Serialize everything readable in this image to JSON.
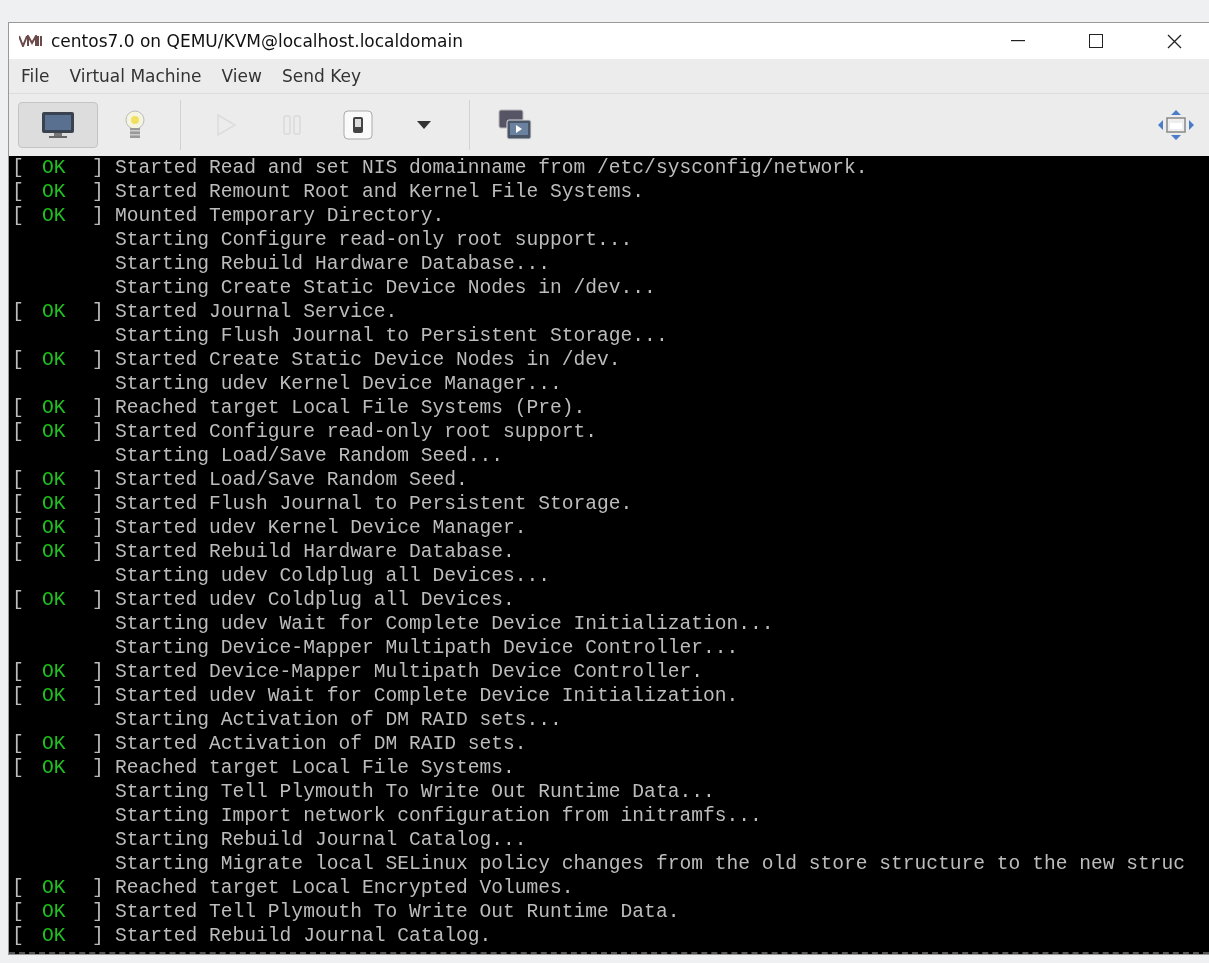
{
  "window": {
    "title": "centos7.0 on QEMU/KVM@localhost.localdomain"
  },
  "menu": [
    "File",
    "Virtual Machine",
    "View",
    "Send Key"
  ],
  "toolbar": [
    {
      "kind": "console",
      "selected": true,
      "disabled": false
    },
    {
      "kind": "details",
      "selected": false,
      "disabled": false
    },
    {
      "kind": "separator"
    },
    {
      "kind": "run",
      "selected": false,
      "disabled": true
    },
    {
      "kind": "pause",
      "selected": false,
      "disabled": true
    },
    {
      "kind": "shutdown",
      "selected": false,
      "disabled": false
    },
    {
      "kind": "dropdown",
      "selected": false,
      "disabled": false
    },
    {
      "kind": "separator"
    },
    {
      "kind": "snapshots",
      "selected": false,
      "disabled": false
    },
    {
      "kind": "spacer"
    },
    {
      "kind": "fullscreen",
      "selected": false,
      "disabled": false
    }
  ],
  "console": {
    "lines": [
      {
        "kind": "status",
        "status": [
          "[",
          "OK",
          "]"
        ],
        "text": "Started Read and set NIS domainname from /etc/sysconfig/network."
      },
      {
        "kind": "status",
        "status": [
          "[",
          "OK",
          "]"
        ],
        "text": "Started Remount Root and Kernel File Systems."
      },
      {
        "kind": "status",
        "status": [
          "[",
          "OK",
          "]"
        ],
        "text": "Mounted Temporary Directory."
      },
      {
        "kind": "plain",
        "text": "Starting Configure read-only root support..."
      },
      {
        "kind": "plain",
        "text": "Starting Rebuild Hardware Database..."
      },
      {
        "kind": "plain",
        "text": "Starting Create Static Device Nodes in /dev..."
      },
      {
        "kind": "status",
        "status": [
          "[",
          "OK",
          "]"
        ],
        "text": "Started Journal Service."
      },
      {
        "kind": "plain",
        "text": "Starting Flush Journal to Persistent Storage..."
      },
      {
        "kind": "status",
        "status": [
          "[",
          "OK",
          "]"
        ],
        "text": "Started Create Static Device Nodes in /dev."
      },
      {
        "kind": "plain",
        "text": "Starting udev Kernel Device Manager..."
      },
      {
        "kind": "status",
        "status": [
          "[",
          "OK",
          "]"
        ],
        "text": "Reached target Local File Systems (Pre)."
      },
      {
        "kind": "status",
        "status": [
          "[",
          "OK",
          "]"
        ],
        "text": "Started Configure read-only root support."
      },
      {
        "kind": "plain",
        "text": "Starting Load/Save Random Seed..."
      },
      {
        "kind": "status",
        "status": [
          "[",
          "OK",
          "]"
        ],
        "text": "Started Load/Save Random Seed."
      },
      {
        "kind": "status",
        "status": [
          "[",
          "OK",
          "]"
        ],
        "text": "Started Flush Journal to Persistent Storage."
      },
      {
        "kind": "status",
        "status": [
          "[",
          "OK",
          "]"
        ],
        "text": "Started udev Kernel Device Manager."
      },
      {
        "kind": "status",
        "status": [
          "[",
          "OK",
          "]"
        ],
        "text": "Started Rebuild Hardware Database."
      },
      {
        "kind": "plain",
        "text": "Starting udev Coldplug all Devices..."
      },
      {
        "kind": "status",
        "status": [
          "[",
          "OK",
          "]"
        ],
        "text": "Started udev Coldplug all Devices."
      },
      {
        "kind": "plain",
        "text": "Starting udev Wait for Complete Device Initialization..."
      },
      {
        "kind": "plain",
        "text": "Starting Device-Mapper Multipath Device Controller..."
      },
      {
        "kind": "status",
        "status": [
          "[",
          "OK",
          "]"
        ],
        "text": "Started Device-Mapper Multipath Device Controller."
      },
      {
        "kind": "status",
        "status": [
          "[",
          "OK",
          "]"
        ],
        "text": "Started udev Wait for Complete Device Initialization."
      },
      {
        "kind": "plain",
        "text": "Starting Activation of DM RAID sets..."
      },
      {
        "kind": "status",
        "status": [
          "[",
          "OK",
          "]"
        ],
        "text": "Started Activation of DM RAID sets."
      },
      {
        "kind": "status",
        "status": [
          "[",
          "OK",
          "]"
        ],
        "text": "Reached target Local File Systems."
      },
      {
        "kind": "plain",
        "text": "Starting Tell Plymouth To Write Out Runtime Data..."
      },
      {
        "kind": "plain",
        "text": "Starting Import network configuration from initramfs..."
      },
      {
        "kind": "plain",
        "text": "Starting Rebuild Journal Catalog..."
      },
      {
        "kind": "plain",
        "text": "Starting Migrate local SELinux policy changes from the old store structure to the new struc"
      },
      {
        "kind": "status",
        "status": [
          "[",
          "OK",
          "]"
        ],
        "text": "Reached target Local Encrypted Volumes."
      },
      {
        "kind": "status",
        "status": [
          "[",
          "OK",
          "]"
        ],
        "text": "Started Tell Plymouth To Write Out Runtime Data."
      },
      {
        "kind": "status",
        "status": [
          "[",
          "OK",
          "]"
        ],
        "text": "Started Rebuild Journal Catalog."
      }
    ]
  }
}
